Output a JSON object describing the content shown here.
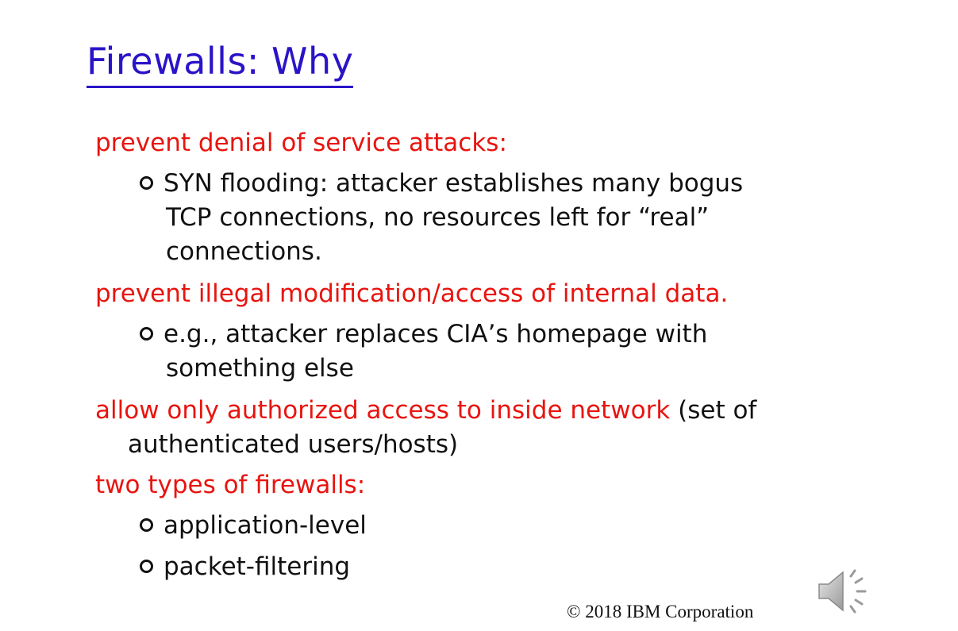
{
  "slide": {
    "title": "Firewalls: Why",
    "sections": [
      {
        "heading": "prevent denial of service attacks:",
        "bullets": [
          {
            "lines": [
              "SYN flooding: attacker establishes many bogus",
              "TCP connections, no resources left for “real”",
              "connections."
            ]
          }
        ]
      },
      {
        "heading": "prevent illegal modification/access of internal data.",
        "bullets": [
          {
            "lines": [
              "e.g., attacker replaces CIA’s homepage with",
              "something else"
            ]
          }
        ]
      },
      {
        "heading_red": "allow only authorized access to inside network",
        "heading_black": " (set of",
        "heading_cont": "authenticated users/hosts)"
      },
      {
        "heading": "two types of firewalls:",
        "bullets": [
          {
            "lines": [
              "application-level"
            ]
          },
          {
            "lines": [
              "packet-filtering"
            ]
          }
        ]
      }
    ],
    "copyright": "© 2018 IBM Corporation",
    "speaker_icon": "speaker-icon"
  },
  "colors": {
    "title": "#2a14c8",
    "heading": "#e8140f",
    "text": "#111111"
  }
}
